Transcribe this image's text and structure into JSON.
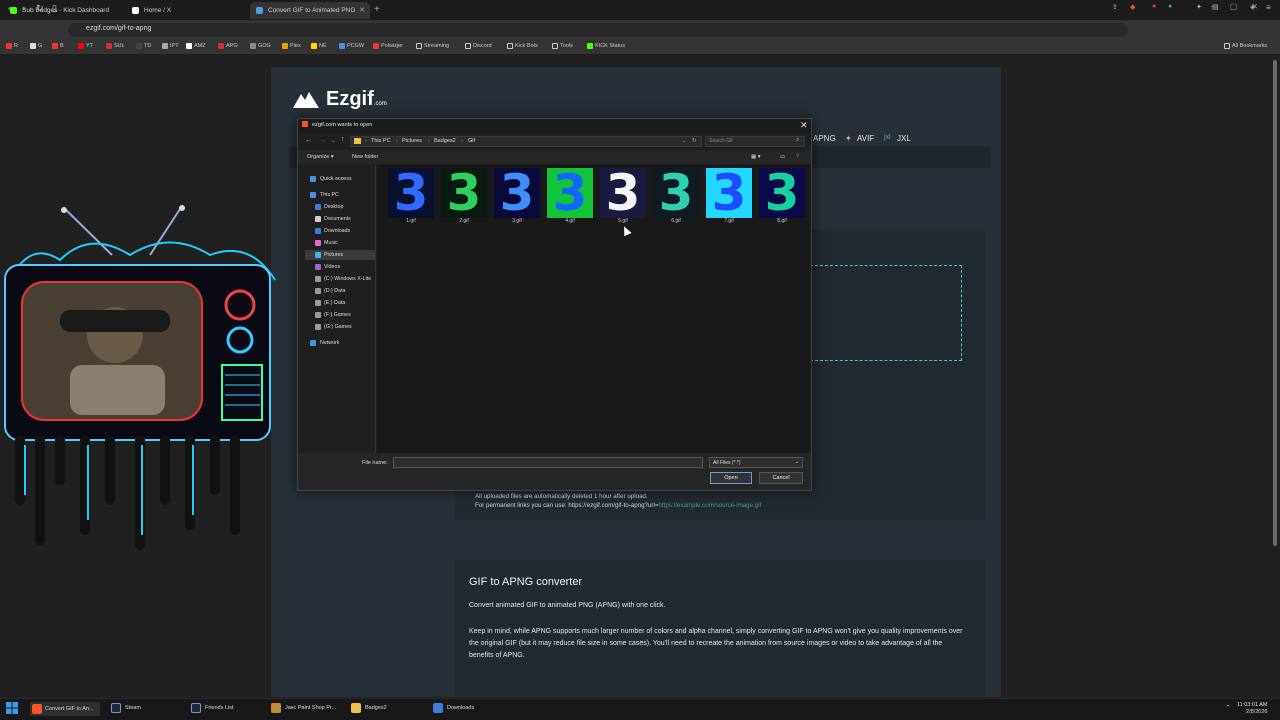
{
  "browser": {
    "tabs": [
      {
        "label": "Sub Badges - Kick Dashboard",
        "icon": "kick-icon",
        "color": "#53fc18"
      },
      {
        "label": "Home / X",
        "icon": "x-icon",
        "color": "#ffffff"
      },
      {
        "label": "Convert GIF to Animated PNG",
        "icon": "ezgif-icon",
        "color": "#4aa3df",
        "active": true
      }
    ],
    "url": "ezgif.com/gif-to-apng",
    "bookmarks": [
      "R",
      "G",
      "B",
      "YT",
      "SUL",
      "TD",
      "IPT",
      "AMZ",
      "APG",
      "GOG",
      "Plex",
      "NE",
      "PCGW",
      "Polwizjer",
      "Streaming",
      "Discord",
      "Kick Bots",
      "Tools",
      "KICK Status"
    ],
    "all_bookmarks": "All Bookmarks"
  },
  "site": {
    "logo": "Ezgif",
    "logo_suffix": ".com",
    "nav": [
      "APNG",
      "AVIF",
      "JXL"
    ],
    "upload_note": "All uploaded files are automatically deleted 1 hour after upload.",
    "permanent_prefix": "For permanent links you can use: https://ezgif.com/gif-to-apng?url=",
    "permanent_link": "https://example.com/source-image.gif",
    "converter_title": "GIF to APNG converter",
    "converter_desc": "Convert animated GIF to animated PNG (APNG) with one click.",
    "converter_note": "Keep in mind, while APNG supports much larger number of colors and alpha channel, simply converting GIF to APNG won't give you quality improvements over the original GIF (but it may reduce file size in some cases). You'll need to recreate the animation from source images or video to take advantage of all the benefits of APNG."
  },
  "dialog": {
    "title": "ezgif.com wants to open",
    "path": [
      "This PC",
      "Pictures",
      "Badges2",
      "Gif"
    ],
    "search_placeholder": "Search Gif",
    "organize": "Organize",
    "new_folder": "New folder",
    "nav": [
      {
        "label": "Quick access",
        "icon": "star-icon",
        "color": "#4a90e2"
      },
      {
        "label": "This PC",
        "icon": "pc-icon",
        "color": "#4a90e2"
      },
      {
        "label": "Desktop",
        "icon": "folder-icon",
        "color": "#3a7fd5"
      },
      {
        "label": "Documents",
        "icon": "document-icon",
        "color": "#cfcfcf"
      },
      {
        "label": "Downloads",
        "icon": "download-icon",
        "color": "#3a7fd5"
      },
      {
        "label": "Music",
        "icon": "music-icon",
        "color": "#e06ad0"
      },
      {
        "label": "Pictures",
        "icon": "picture-icon",
        "color": "#4ab0e8",
        "selected": true
      },
      {
        "label": "Videos",
        "icon": "video-icon",
        "color": "#9b6ad0"
      },
      {
        "label": "(C:) Windows X-Lite",
        "icon": "drive-icon",
        "color": "#9a9a9a"
      },
      {
        "label": "(D:) Data",
        "icon": "drive-icon",
        "color": "#9a9a9a"
      },
      {
        "label": "(E:) Data",
        "icon": "drive-icon",
        "color": "#9a9a9a"
      },
      {
        "label": "(F:) Games",
        "icon": "drive-icon",
        "color": "#9a9a9a"
      },
      {
        "label": "(G:) Games",
        "icon": "drive-icon",
        "color": "#9a9a9a"
      },
      {
        "label": "Network",
        "icon": "network-icon",
        "color": "#4a90e2"
      }
    ],
    "files": [
      {
        "name": "1.gif",
        "glyph": "3",
        "color": "#2f6bff",
        "bg": "#0a1030"
      },
      {
        "name": "2.gif",
        "glyph": "3",
        "color": "#2fd060",
        "bg": "#0a1a10"
      },
      {
        "name": "3.gif",
        "glyph": "3",
        "color": "#3f8cff",
        "bg": "#0a0a3a"
      },
      {
        "name": "4.gif",
        "glyph": "3",
        "color": "#1565ff",
        "bg": "#11c43a"
      },
      {
        "name": "5.gif",
        "glyph": "3",
        "color": "#f5f5f5",
        "bg": "#1a1a40"
      },
      {
        "name": "6.gif",
        "glyph": "3",
        "color": "#2fd0b0",
        "bg": "#101a25"
      },
      {
        "name": "7.gif",
        "glyph": "3",
        "color": "#1d4bff",
        "bg": "#22d8ff"
      },
      {
        "name": "8.gif",
        "glyph": "3",
        "color": "#16d2a0",
        "bg": "#0a0a4a"
      }
    ],
    "file_name_label": "File name:",
    "file_name_value": "",
    "file_type": "All Files (*.*)",
    "open": "Open",
    "cancel": "Cancel"
  },
  "taskbar": {
    "items": [
      {
        "label": "Convert GIF to An...",
        "icon": "brave-icon",
        "color": "#fb542b",
        "active": true
      },
      {
        "label": "Steam",
        "icon": "steam-icon",
        "color": "#1b2838"
      },
      {
        "label": "Friends List",
        "icon": "steam-friends-icon",
        "color": "#1b2838"
      },
      {
        "label": "Jasc Paint Shop Pr...",
        "icon": "paintshop-icon",
        "color": "#c08a3a"
      },
      {
        "label": "Badges2",
        "icon": "folder-icon",
        "color": "#e8c24a"
      },
      {
        "label": "Downloads",
        "icon": "download-icon",
        "color": "#3a7fd5"
      }
    ],
    "time": "11:03:01 AM",
    "date": "2/8/2026"
  }
}
